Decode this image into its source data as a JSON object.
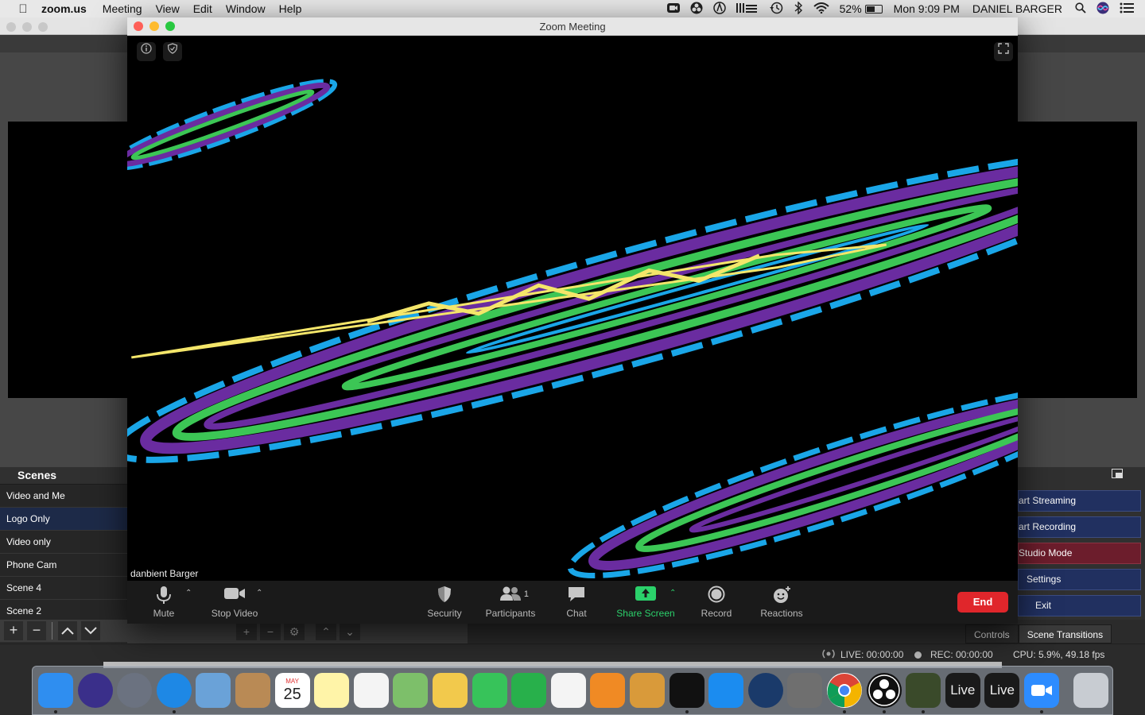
{
  "menubar": {
    "app_name": "zoom.us",
    "menus": [
      "Meeting",
      "View",
      "Edit",
      "Window",
      "Help"
    ],
    "battery": "52%",
    "clock": "Mon 9:09 PM",
    "user": "DANIEL BARGER",
    "status_icons": [
      "zoom-status-icon",
      "obs-status-icon",
      "audio-hijack-icon",
      "sound-bars-icon",
      "time-machine-icon",
      "bluetooth-icon",
      "wifi-icon"
    ]
  },
  "zoom": {
    "window_title": "Zoom Meeting",
    "participant_name": "danbient Barger",
    "participants_count": "1",
    "toolbar": {
      "mute": "Mute",
      "stop_video": "Stop Video",
      "security": "Security",
      "participants": "Participants",
      "chat": "Chat",
      "share_screen": "Share Screen",
      "record": "Record",
      "reactions": "Reactions",
      "end": "End"
    },
    "colors": {
      "share_green": "#2bd16b",
      "end_red": "#e0262b"
    }
  },
  "obs": {
    "scenes_title": "Scenes",
    "scenes": [
      "Video and Me",
      "Logo Only",
      "Video only",
      "Phone Cam",
      "Scene 4",
      "Scene 2"
    ],
    "selected_scene": "Logo Only",
    "controls": {
      "start_streaming": "art Streaming",
      "start_recording": "art Recording",
      "studio_mode": "Studio Mode",
      "settings": "Settings",
      "exit": "Exit"
    },
    "tabs": {
      "controls": "Controls",
      "scene_transitions": "Scene Transitions"
    },
    "status": {
      "live": "LIVE: 00:00:00",
      "rec": "REC: 00:00:00",
      "cpu": "CPU: 5.9%, 49.18 fps"
    }
  },
  "dock": {
    "items": [
      {
        "name": "finder-icon",
        "color": "#2f8ef0",
        "running": true
      },
      {
        "name": "siri-icon",
        "color": "#3a2f8a",
        "running": false
      },
      {
        "name": "launchpad-icon",
        "color": "#6b7280",
        "running": false
      },
      {
        "name": "safari-icon",
        "color": "#1e88e5",
        "running": true
      },
      {
        "name": "mail-icon",
        "color": "#6aa2d8",
        "running": false
      },
      {
        "name": "contacts-icon",
        "color": "#b98a55",
        "running": false
      },
      {
        "name": "calendar-icon",
        "color": "#ffffff",
        "running": false
      },
      {
        "name": "notes-icon",
        "color": "#fff4a8",
        "running": false
      },
      {
        "name": "reminders-icon",
        "color": "#f4f4f4",
        "running": false
      },
      {
        "name": "maps-icon",
        "color": "#7dbf6a",
        "running": false
      },
      {
        "name": "photos-icon",
        "color": "#f2c94c",
        "running": false
      },
      {
        "name": "messages-icon",
        "color": "#37c35a",
        "running": false
      },
      {
        "name": "facetime-icon",
        "color": "#28b04b",
        "running": false
      },
      {
        "name": "itunes-icon",
        "color": "#f4f4f4",
        "running": false
      },
      {
        "name": "books-icon",
        "color": "#f08a24",
        "running": false
      },
      {
        "name": "garageband-icon",
        "color": "#d99a3a",
        "running": false
      },
      {
        "name": "piano-icon",
        "color": "#111111",
        "running": true
      },
      {
        "name": "app-store-icon",
        "color": "#1b8cf0",
        "running": false
      },
      {
        "name": "quicktime-icon",
        "color": "#1a3a6a",
        "running": false
      },
      {
        "name": "system-preferences-icon",
        "color": "#6f6f6f",
        "running": false
      },
      {
        "name": "chrome-icon",
        "color": "#ffffff",
        "running": true
      },
      {
        "name": "obs-icon",
        "color": "#111111",
        "running": true
      },
      {
        "name": "video-editor-icon",
        "color": "#3a4a2a",
        "running": true
      },
      {
        "name": "ableton-live-icon",
        "color": "#1a1a1a",
        "label": "Live",
        "running": false
      },
      {
        "name": "ableton-live-2-icon",
        "color": "#1a1a1a",
        "label": "Live",
        "running": false
      },
      {
        "name": "zoom-icon",
        "color": "#2d8cff",
        "running": true
      },
      {
        "name": "trash-icon",
        "color": "#c8ccd2",
        "running": false
      }
    ],
    "calendar_month": "MAY",
    "calendar_day": "25"
  }
}
